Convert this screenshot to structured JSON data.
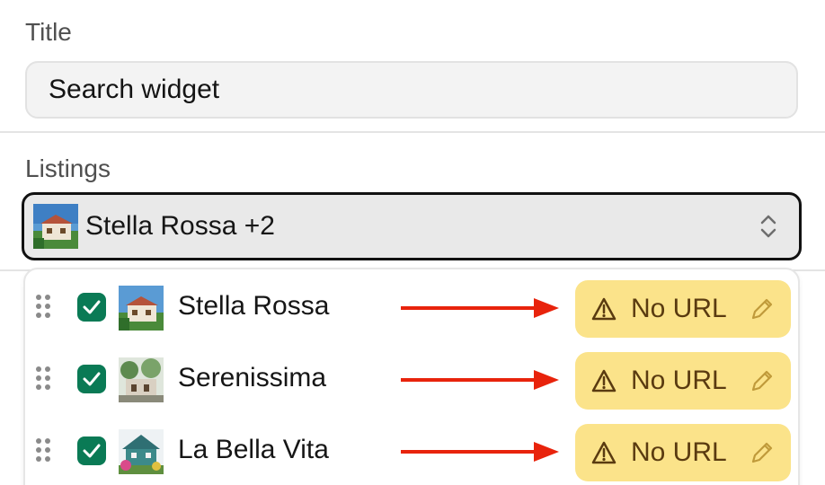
{
  "title_field": {
    "label": "Title",
    "value": "Search widget"
  },
  "listings_field": {
    "label": "Listings",
    "selected_text": "Stella Rossa +2",
    "icon": "chevron-up-down-icon"
  },
  "listings": [
    {
      "name": "Stella Rossa",
      "checked": true,
      "status": "No URL"
    },
    {
      "name": "Serenissima",
      "checked": true,
      "status": "No URL"
    },
    {
      "name": "La Bella Vita",
      "checked": true,
      "status": "No URL"
    }
  ],
  "colors": {
    "checkbox": "#0a7a55",
    "warning_badge_bg": "#fbe38a",
    "warning_text": "#5a3b10",
    "annotation_arrow": "#e8230c"
  }
}
